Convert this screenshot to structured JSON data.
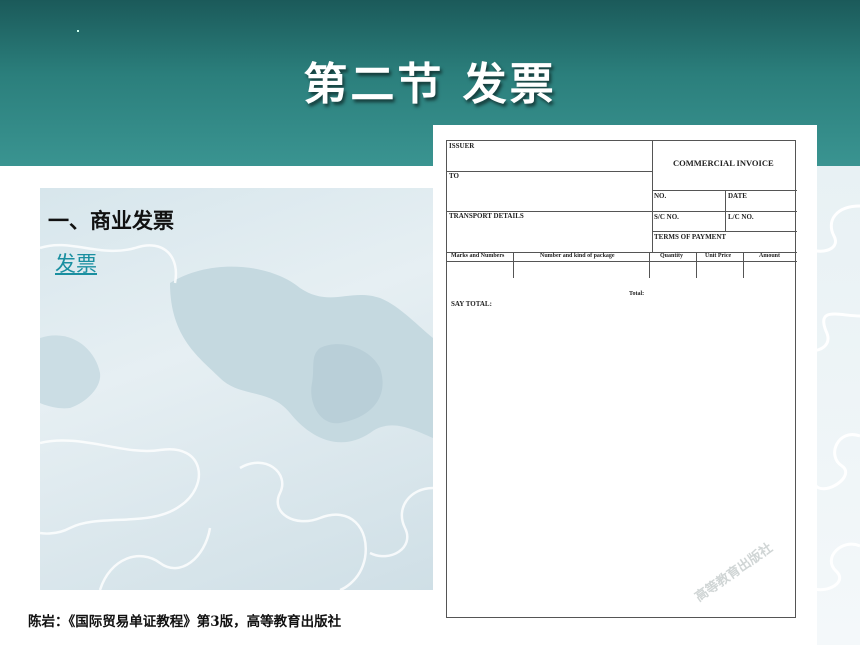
{
  "header": {
    "title": "第二节 发票"
  },
  "section": {
    "heading": "一、商业发票",
    "link_label": "发票"
  },
  "citation": "陈岩：《国际贸易单证教程》第3版，高等教育出版社",
  "invoice_form": {
    "issuer": "ISSUER",
    "to": "TO",
    "title": "COMMERCIAL INVOICE",
    "no": "NO.",
    "date": "DATE",
    "transport_details": "TRANSPORT DETAILS",
    "sc_no": "S/C NO.",
    "lc_no": "L/C NO.",
    "terms_of_payment": "TERMS OF PAYMENT",
    "columns": [
      "Marks and Numbers",
      "Number and kind of package",
      "Quantity",
      "Unit Price",
      "Amount"
    ],
    "total": "Total:",
    "say_total": "SAY TOTAL:"
  },
  "watermark": "高等教育出版社",
  "colors": {
    "header_dark": "#1b5a5a",
    "header_light": "#3a9491",
    "link": "#1a8fa0"
  }
}
